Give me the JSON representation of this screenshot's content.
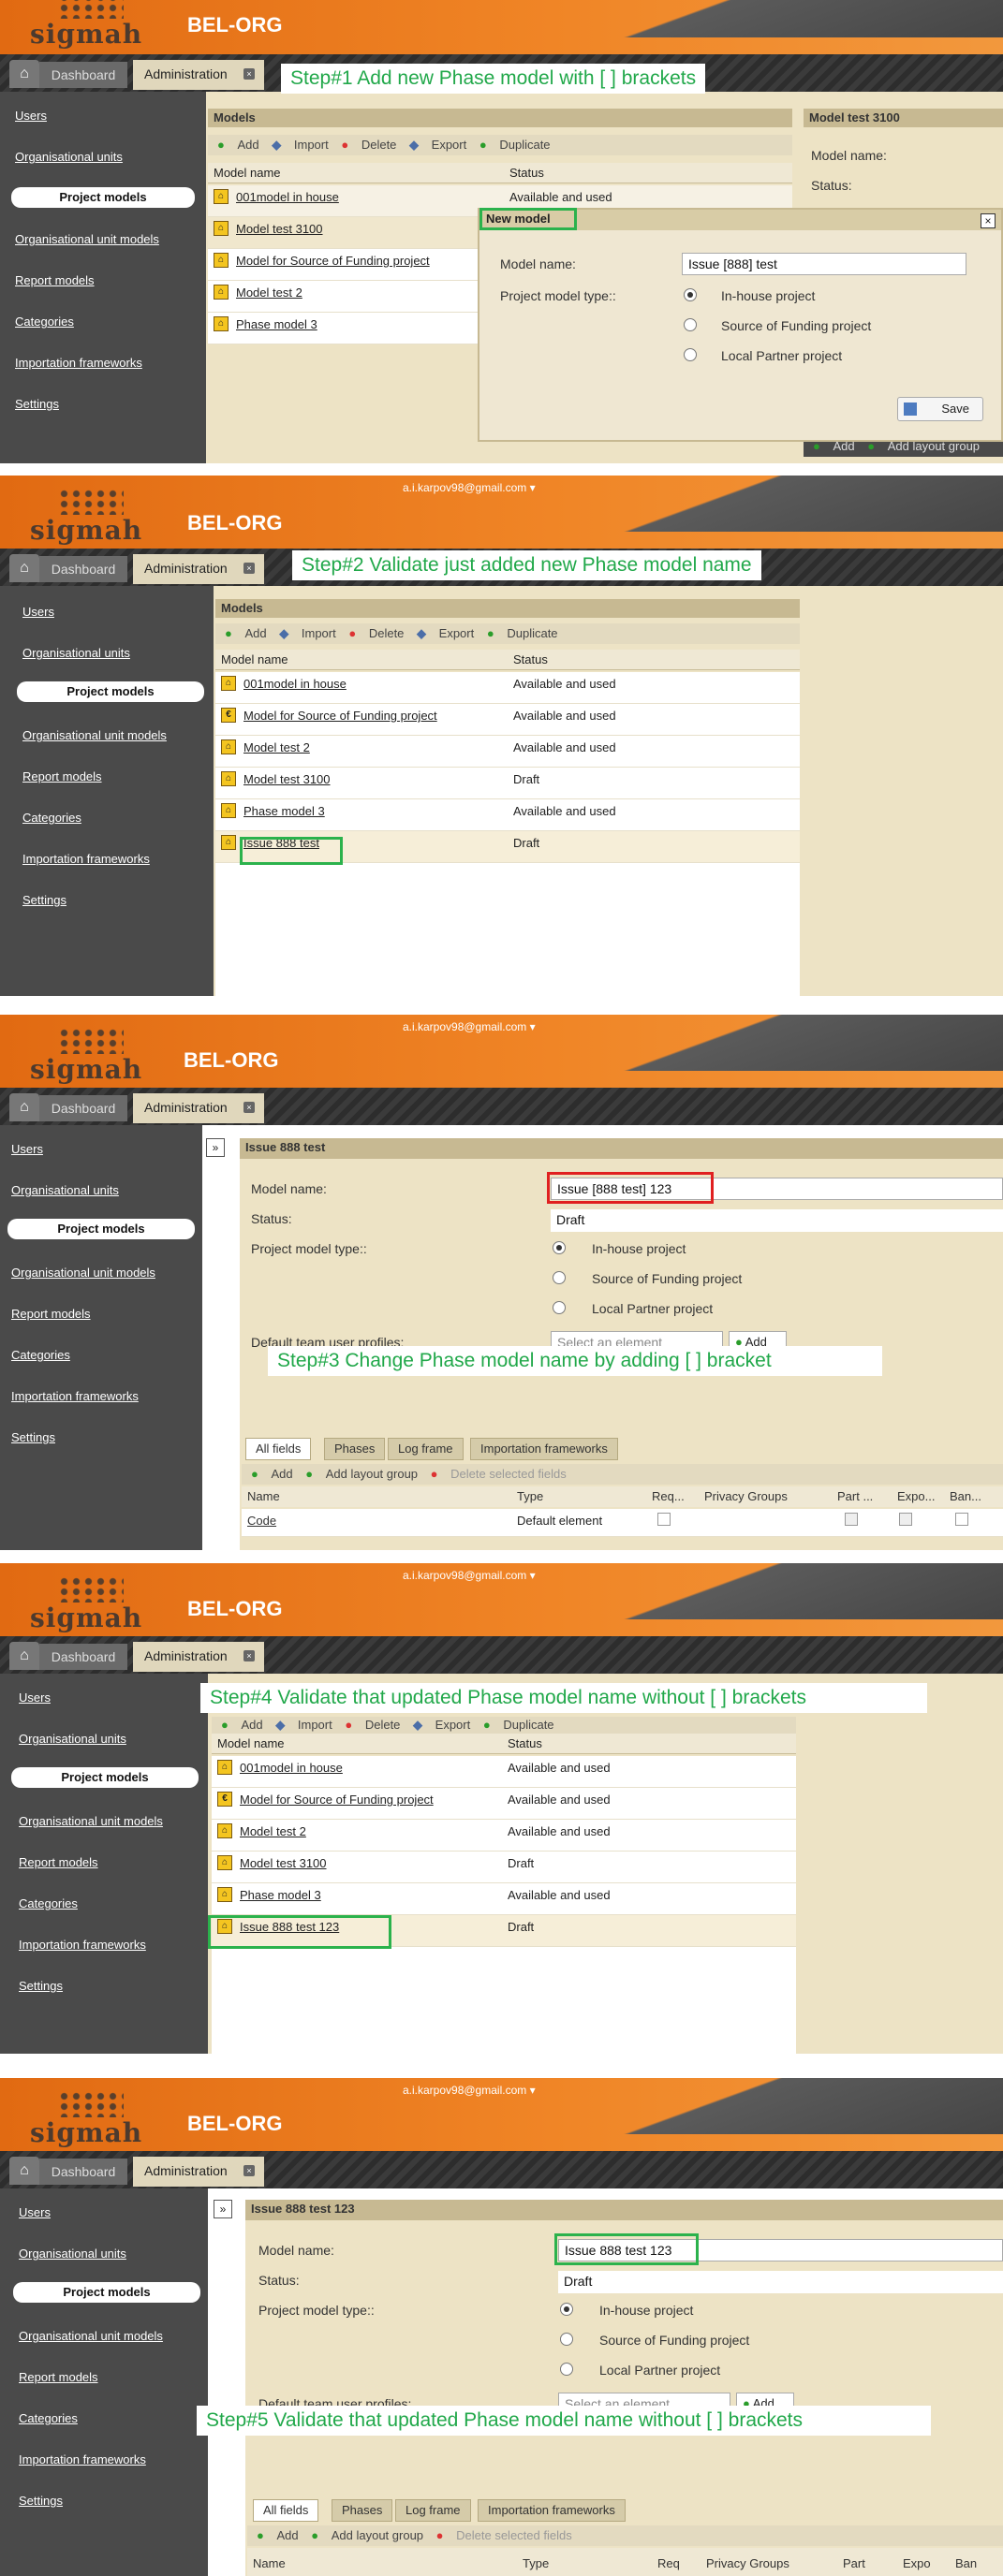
{
  "app": {
    "brand": "BEL-ORG",
    "logo_text": "sigmah",
    "user": "a.i.karpov98@gmail.com ▾",
    "tab_dashboard": "Dashboard",
    "tab_admin": "Administration"
  },
  "sidebar": [
    "Users",
    "Organisational units",
    "Project models",
    "Organisational unit models",
    "Report models",
    "Categories",
    "Importation frameworks",
    "Settings"
  ],
  "toolbar": {
    "add": "Add",
    "import": "Import",
    "delete": "Delete",
    "export": "Export",
    "duplicate": "Duplicate"
  },
  "models_panel": {
    "title": "Models",
    "col_name": "Model name",
    "col_status": "Status"
  },
  "step1": {
    "label": "Step#1 Add new Phase model with [ ] brackets",
    "rows": [
      {
        "name": "001model in house",
        "status": "Available and used"
      },
      {
        "name": "Model test 3100",
        "status": ""
      },
      {
        "name": "Model for Source of Funding project",
        "status": ""
      },
      {
        "name": "Model test 2",
        "status": ""
      },
      {
        "name": "Phase model 3",
        "status": ""
      }
    ],
    "right_title": "Model test 3100",
    "right_name_label": "Model name:",
    "right_status_label": "Status:",
    "right_add": "Add",
    "right_add_layout": "Add layout group",
    "dialog_title": "New model",
    "dialog_name_label": "Model name:",
    "dialog_name_value": "Issue [888] test",
    "dialog_type_label": "Project model type::",
    "types": [
      "In-house project",
      "Source of Funding project",
      "Local Partner project"
    ],
    "save": "Save"
  },
  "step2": {
    "label": "Step#2 Validate just added new Phase model name",
    "rows": [
      {
        "name": "001model in house",
        "status": "Available and used"
      },
      {
        "name": "Model for Source of Funding project",
        "status": "Available and used"
      },
      {
        "name": "Model test 2",
        "status": "Available and used"
      },
      {
        "name": "Model test 3100",
        "status": "Draft"
      },
      {
        "name": "Phase model 3",
        "status": "Available and used"
      },
      {
        "name": "Issue 888 test",
        "status": "Draft"
      }
    ]
  },
  "step3": {
    "label": "Step#3 Change Phase model name by adding [ ] bracket",
    "title": "Issue 888 test",
    "name_label": "Model name:",
    "name_value": "Issue [888 test] 123",
    "status_label": "Status:",
    "status_value": "Draft",
    "type_label": "Project model type::",
    "profiles_label": "Default team user profiles:",
    "select_placeholder": "Select an element",
    "add": "Add"
  },
  "step4": {
    "label": "Step#4 Validate that updated Phase model name without [ ] brackets",
    "rows": [
      {
        "name": "001model in house",
        "status": "Available and used"
      },
      {
        "name": "Model for Source of Funding project",
        "status": "Available and used"
      },
      {
        "name": "Model test 2",
        "status": "Available and used"
      },
      {
        "name": "Model test 3100",
        "status": "Draft"
      },
      {
        "name": "Phase model 3",
        "status": "Available and used"
      },
      {
        "name": "Issue 888 test 123",
        "status": "Draft"
      }
    ]
  },
  "step5": {
    "label": "Step#5 Validate that updated Phase model name without [ ] brackets",
    "title": "Issue 888 test 123",
    "name_value": "Issue 888 test 123",
    "status_value": "Draft"
  },
  "field_tabs": [
    "All fields",
    "Phases",
    "Log frame",
    "Importation frameworks"
  ],
  "field_toolbar": {
    "add": "Add",
    "add_layout": "Add layout group",
    "delete_sel": "Delete selected fields"
  },
  "grid_cols": [
    "Name",
    "Type",
    "Req...",
    "Privacy Groups",
    "Part ...",
    "Expo...",
    "Ban..."
  ],
  "grid_cols_short": [
    "Name",
    "Type",
    "Req",
    "Privacy Groups",
    "Part",
    "Expo",
    "Ban"
  ],
  "grid_row": {
    "name": "Code",
    "type": "Default element"
  }
}
